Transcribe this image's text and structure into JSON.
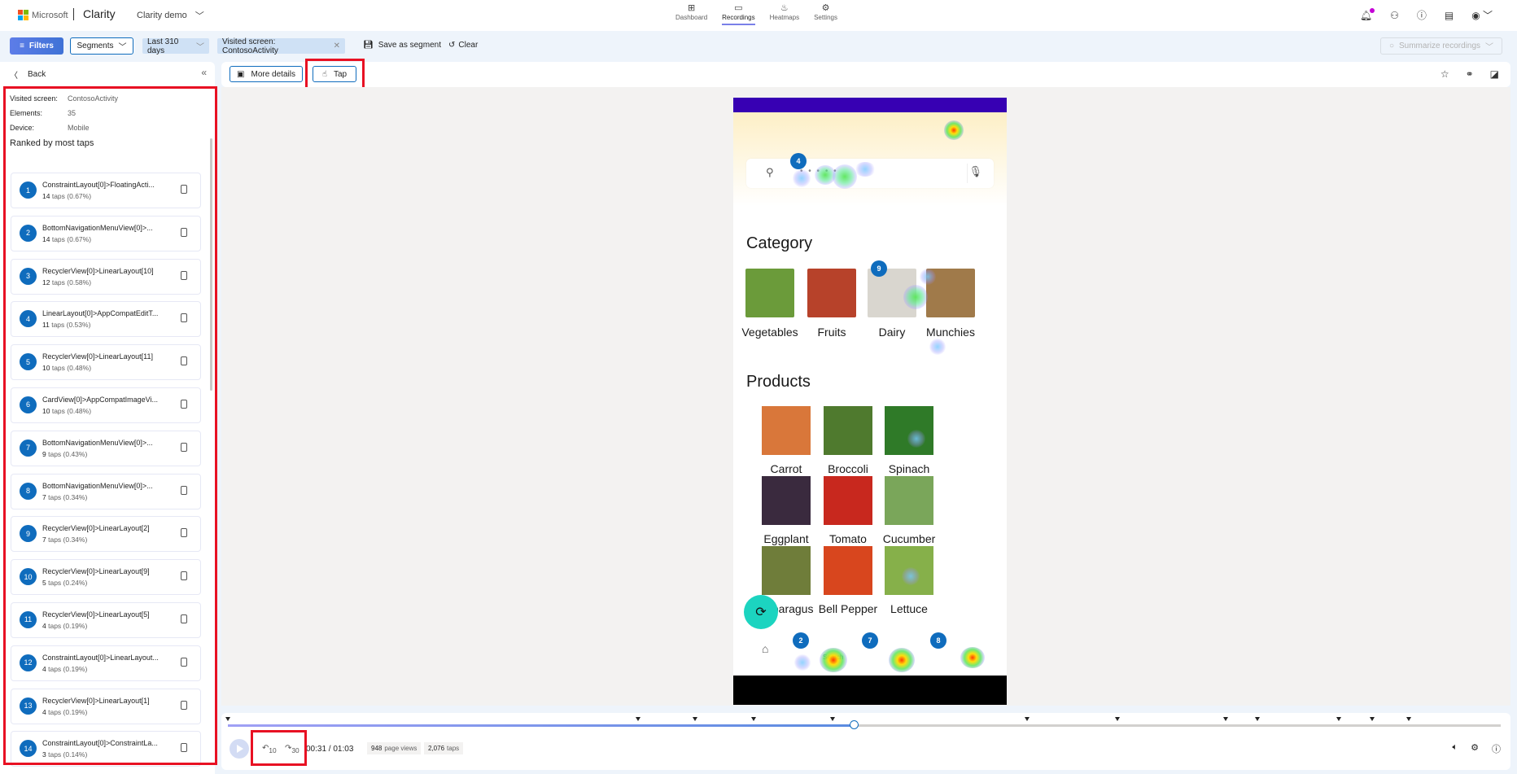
{
  "header": {
    "ms_label": "Microsoft",
    "brand": "Clarity",
    "project": "Clarity demo",
    "nav": [
      {
        "label": "Dashboard",
        "icon": "dashboard-icon",
        "glyph": "⊞",
        "active": false
      },
      {
        "label": "Recordings",
        "icon": "video-icon",
        "glyph": "▭",
        "active": true
      },
      {
        "label": "Heatmaps",
        "icon": "flame-icon",
        "glyph": "♨",
        "active": false
      },
      {
        "label": "Settings",
        "icon": "gear-icon",
        "glyph": "⚙",
        "active": false
      }
    ]
  },
  "filterbar": {
    "filters_label": "Filters",
    "segments_label": "Segments",
    "date_chip": "Last 310 days",
    "screen_chip": "Visited screen: ContosoActivity",
    "save_segment": "Save as segment",
    "clear": "Clear",
    "summarize": "Summarize recordings"
  },
  "left_panel": {
    "back": "Back",
    "meta": [
      {
        "key": "Visited screen:",
        "value": "ContosoActivity"
      },
      {
        "key": "Elements:",
        "value": "35"
      },
      {
        "key": "Device:",
        "value": "Mobile"
      }
    ],
    "ranked_title": "Ranked by most taps",
    "items": [
      {
        "rank": "1",
        "path": "ConstraintLayout[0]>FloatingActi...",
        "taps": "14",
        "pct": "taps (0.67%)"
      },
      {
        "rank": "2",
        "path": "BottomNavigationMenuView[0]>...",
        "taps": "14",
        "pct": "taps (0.67%)"
      },
      {
        "rank": "3",
        "path": "RecyclerView[0]>LinearLayout[10]",
        "taps": "12",
        "pct": "taps (0.58%)"
      },
      {
        "rank": "4",
        "path": "LinearLayout[0]>AppCompatEditT...",
        "taps": "11",
        "pct": "taps (0.53%)"
      },
      {
        "rank": "5",
        "path": "RecyclerView[0]>LinearLayout[11]",
        "taps": "10",
        "pct": "taps (0.48%)"
      },
      {
        "rank": "6",
        "path": "CardView[0]>AppCompatImageVi...",
        "taps": "10",
        "pct": "taps (0.48%)"
      },
      {
        "rank": "7",
        "path": "BottomNavigationMenuView[0]>...",
        "taps": "9",
        "pct": "taps (0.43%)"
      },
      {
        "rank": "8",
        "path": "BottomNavigationMenuView[0]>...",
        "taps": "7",
        "pct": "taps (0.34%)"
      },
      {
        "rank": "9",
        "path": "RecyclerView[0]>LinearLayout[2]",
        "taps": "7",
        "pct": "taps (0.34%)"
      },
      {
        "rank": "10",
        "path": "RecyclerView[0]>LinearLayout[9]",
        "taps": "5",
        "pct": "taps (0.24%)"
      },
      {
        "rank": "11",
        "path": "RecyclerView[0]>LinearLayout[5]",
        "taps": "4",
        "pct": "taps (0.19%)"
      },
      {
        "rank": "12",
        "path": "ConstraintLayout[0]>LinearLayout...",
        "taps": "4",
        "pct": "taps (0.19%)"
      },
      {
        "rank": "13",
        "path": "RecyclerView[0]>LinearLayout[1]",
        "taps": "4",
        "pct": "taps (0.19%)"
      },
      {
        "rank": "14",
        "path": "ConstraintLayout[0]>ConstraintLa...",
        "taps": "3",
        "pct": "taps (0.14%)"
      }
    ]
  },
  "toolbar": {
    "more_details": "More details",
    "tap": "Tap"
  },
  "phone": {
    "search_placeholder": "• • • • •",
    "category_title": "Category",
    "categories": [
      {
        "label": "Vegetables",
        "color": "#6b9b3a"
      },
      {
        "label": "Fruits",
        "color": "#b7422a"
      },
      {
        "label": "Dairy",
        "color": "#d9d6cf"
      },
      {
        "label": "Munchies",
        "color": "#a07a4a"
      }
    ],
    "products_title": "Products",
    "products": [
      {
        "label": "Carrot",
        "color": "#d9773a"
      },
      {
        "label": "Broccoli",
        "color": "#4f7a2e"
      },
      {
        "label": "Spinach",
        "color": "#2f7a28"
      },
      {
        "label": "Eggplant",
        "color": "#3a2a3e"
      },
      {
        "label": "Tomato",
        "color": "#c8281e"
      },
      {
        "label": "Cucumber",
        "color": "#7aa65a"
      },
      {
        "label": "Asparagus",
        "color": "#6f7d3a"
      },
      {
        "label": "Bell Pepper",
        "color": "#d8461e"
      },
      {
        "label": "Lettuce",
        "color": "#86b04a"
      }
    ],
    "bottom_nav_search": "Search",
    "badges": [
      "4",
      "9",
      "2",
      "7",
      "8"
    ]
  },
  "player": {
    "time": "00:31 / 01:03",
    "progress": 0.492,
    "markers": [
      0,
      0.322,
      0.367,
      0.413,
      0.475,
      0.628,
      0.699,
      0.784,
      0.809,
      0.873,
      0.899,
      0.928
    ],
    "page_views_count": "948",
    "page_views_label": "page views",
    "taps_count": "2,076",
    "taps_label": "taps",
    "skip_back": "10",
    "skip_forward": "30"
  }
}
